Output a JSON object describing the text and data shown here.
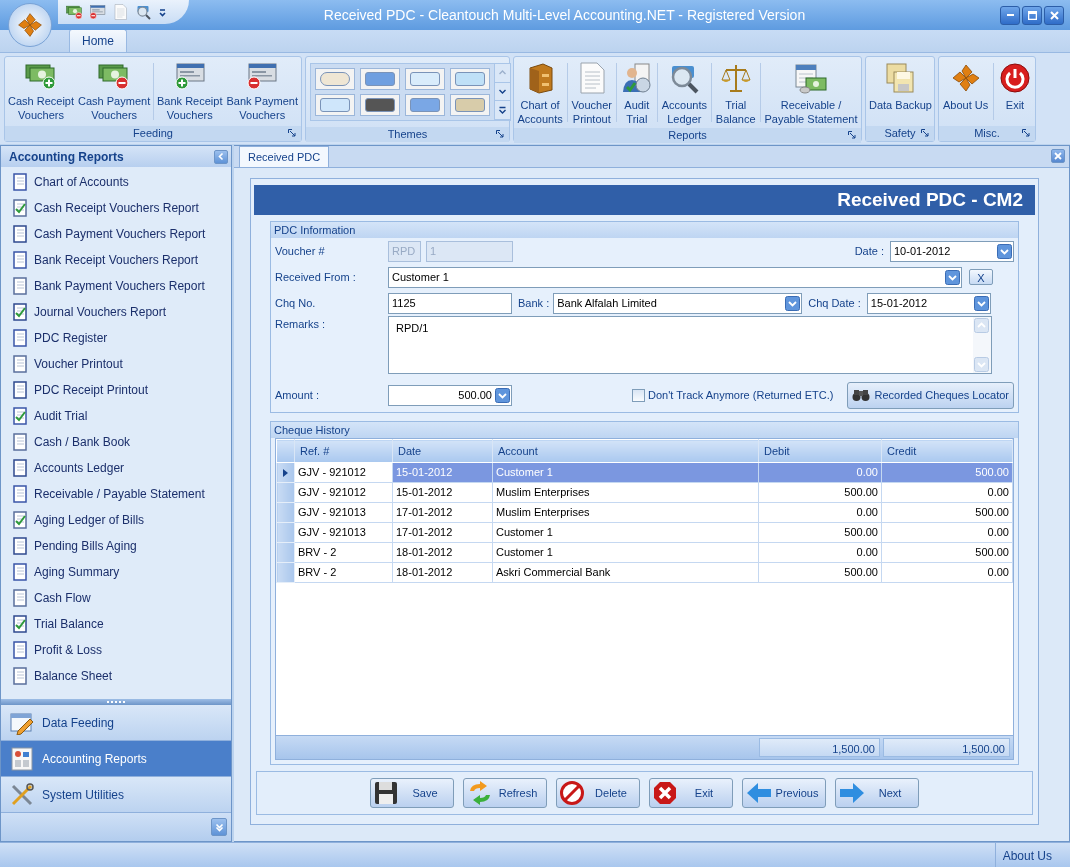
{
  "window": {
    "title": "Received PDC - Cleantouch Multi-Level Accounting.NET - Registered Version"
  },
  "ribbon": {
    "tabs": [
      {
        "label": "Home",
        "selected": true
      }
    ],
    "groups": [
      {
        "label": "Feeding",
        "kind": "buttons",
        "buttons": [
          {
            "lines": [
              "Cash Receipt",
              "Vouchers"
            ]
          },
          {
            "lines": [
              "Cash Payment",
              "Vouchers"
            ]
          },
          {
            "lines": [
              "Bank Receipt",
              "Vouchers"
            ]
          },
          {
            "lines": [
              "Bank Payment",
              "Vouchers"
            ]
          }
        ]
      },
      {
        "label": "Themes",
        "kind": "gallery"
      },
      {
        "label": "Reports",
        "kind": "buttons",
        "buttons": [
          {
            "lines": [
              "Chart of",
              "Accounts"
            ]
          },
          {
            "lines": [
              "Voucher",
              "Printout"
            ]
          },
          {
            "lines": [
              "Audit",
              "Trial"
            ]
          },
          {
            "lines": [
              "Accounts",
              "Ledger"
            ]
          },
          {
            "lines": [
              "Trial",
              "Balance"
            ]
          },
          {
            "lines": [
              "Receivable /",
              "Payable Statement"
            ]
          }
        ]
      },
      {
        "label": "Safety",
        "kind": "buttons",
        "buttons": [
          {
            "lines": [
              "Data Backup"
            ]
          }
        ]
      },
      {
        "label": "Misc.",
        "kind": "buttons",
        "buttons": [
          {
            "lines": [
              "About Us"
            ]
          },
          {
            "lines": [
              "Exit"
            ]
          }
        ]
      }
    ]
  },
  "sidebar": {
    "title": "Accounting Reports",
    "items": [
      "Chart of Accounts",
      "Cash Receipt Vouchers Report",
      "Cash Payment Vouchers Report",
      "Bank Receipt Vouchers Report",
      "Bank Payment Vouchers Report",
      "Journal Vouchers Report",
      "PDC Register",
      "Voucher Printout",
      "PDC Receipt Printout",
      "Audit Trial",
      "Cash / Bank Book",
      "Accounts Ledger",
      "Receivable / Payable Statement",
      "Aging Ledger of Bills",
      "Pending Bills Aging",
      "Aging Summary",
      "Cash Flow",
      "Trial Balance",
      "Profit & Loss",
      "Balance Sheet"
    ],
    "nav": [
      {
        "label": "Data Feeding",
        "selected": false
      },
      {
        "label": "Accounting Reports",
        "selected": true
      },
      {
        "label": "System Utilities",
        "selected": false
      }
    ]
  },
  "document_tabs": [
    {
      "label": "Received PDC",
      "selected": true
    }
  ],
  "form": {
    "title": "Received PDC - CM2",
    "pdc_information": {
      "title": "PDC Information",
      "voucher": {
        "label": "Voucher #",
        "prefix": "RPD",
        "number": "1",
        "disabled": true
      },
      "date": {
        "label": "Date :",
        "value": "10-01-2012"
      },
      "received_from": {
        "label": "Received From :",
        "value": "Customer 1",
        "clear_button": "X"
      },
      "chq_no": {
        "label": "Chq No.",
        "value": "1125"
      },
      "bank": {
        "label": "Bank :",
        "value": "Bank Alfalah Limited"
      },
      "chq_date": {
        "label": "Chq Date :",
        "value": "15-01-2012"
      },
      "remarks": {
        "label": "Remarks :",
        "value": "RPD/1"
      },
      "amount": {
        "label": "Amount :",
        "value": "500.00"
      },
      "dont_track": {
        "label": "Don't Track Anymore (Returned ETC.)",
        "checked": false
      },
      "locator_button": "Recorded Cheques Locator"
    },
    "cheque_history": {
      "title": "Cheque History",
      "columns": [
        "Ref. #",
        "Date",
        "Account",
        "Debit",
        "Credit"
      ],
      "rows": [
        {
          "cells": [
            "GJV - 921012",
            "15-01-2012",
            "Customer 1",
            "0.00",
            "500.00"
          ],
          "selected": true
        },
        {
          "cells": [
            "GJV - 921012",
            "15-01-2012",
            "Muslim Enterprises",
            "500.00",
            "0.00"
          ],
          "selected": false
        },
        {
          "cells": [
            "GJV - 921013",
            "17-01-2012",
            "Muslim Enterprises",
            "0.00",
            "500.00"
          ],
          "selected": false
        },
        {
          "cells": [
            "GJV - 921013",
            "17-01-2012",
            "Customer 1",
            "500.00",
            "0.00"
          ],
          "selected": false
        },
        {
          "cells": [
            "BRV - 2",
            "18-01-2012",
            "Customer 1",
            "0.00",
            "500.00"
          ],
          "selected": false
        },
        {
          "cells": [
            "BRV - 2",
            "18-01-2012",
            "Askri Commercial Bank",
            "500.00",
            "0.00"
          ],
          "selected": false
        }
      ],
      "totals": {
        "debit": "1,500.00",
        "credit": "1,500.00"
      }
    },
    "buttons": [
      "Save",
      "Refresh",
      "Delete",
      "Exit",
      "Previous",
      "Next"
    ]
  },
  "status_bar": {
    "text": "About Us"
  }
}
